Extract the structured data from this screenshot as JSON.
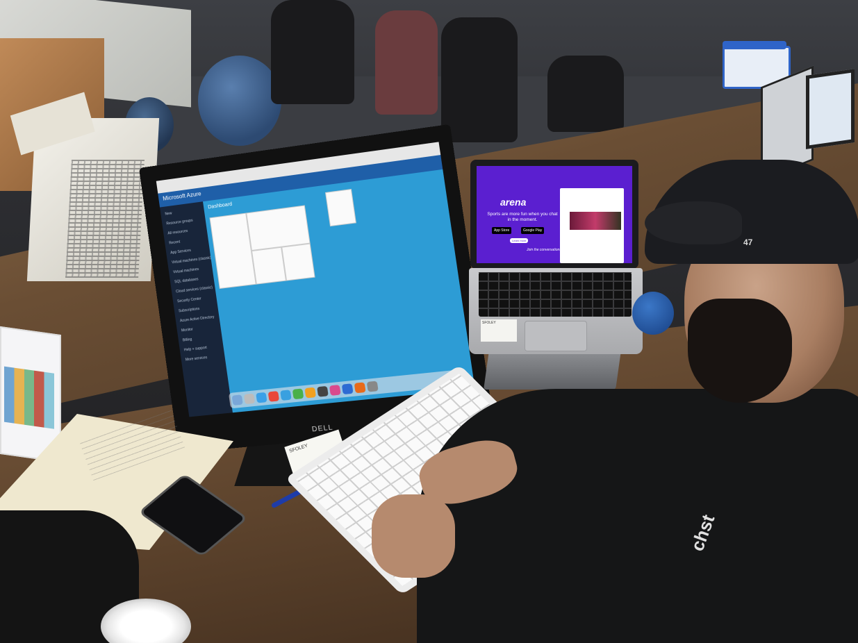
{
  "scene": {
    "description_colors": {
      "laptop_screen": "#5b1fd0",
      "azure_blue": "#2f9ed3",
      "desk": "#7a5b3e"
    }
  },
  "monitor": {
    "brand": "DELL",
    "portal_title": "Microsoft Azure",
    "dashboard_label": "Dashboard",
    "sidebar_items": [
      "New",
      "Resource groups",
      "All resources",
      "Recent",
      "App Services",
      "Virtual machines (classic)",
      "Virtual machines",
      "SQL databases",
      "Cloud services (classic)",
      "Security Center",
      "Subscriptions",
      "Azure Active Directory",
      "Monitor",
      "Billing",
      "Help + support",
      "More services"
    ]
  },
  "laptop": {
    "logo": "arena",
    "tagline": "Sports are more fun when you chat in the moment.",
    "app_store": "App Store",
    "google_play": "Google Play",
    "learn_more": "Learn more",
    "join": "Join the conversation!"
  },
  "notes": {
    "laptop_sticky": "SFOLEY",
    "desk_card": "SFOLEY"
  },
  "apparel": {
    "cap_logo": "47",
    "shirt_logo": "chst"
  }
}
